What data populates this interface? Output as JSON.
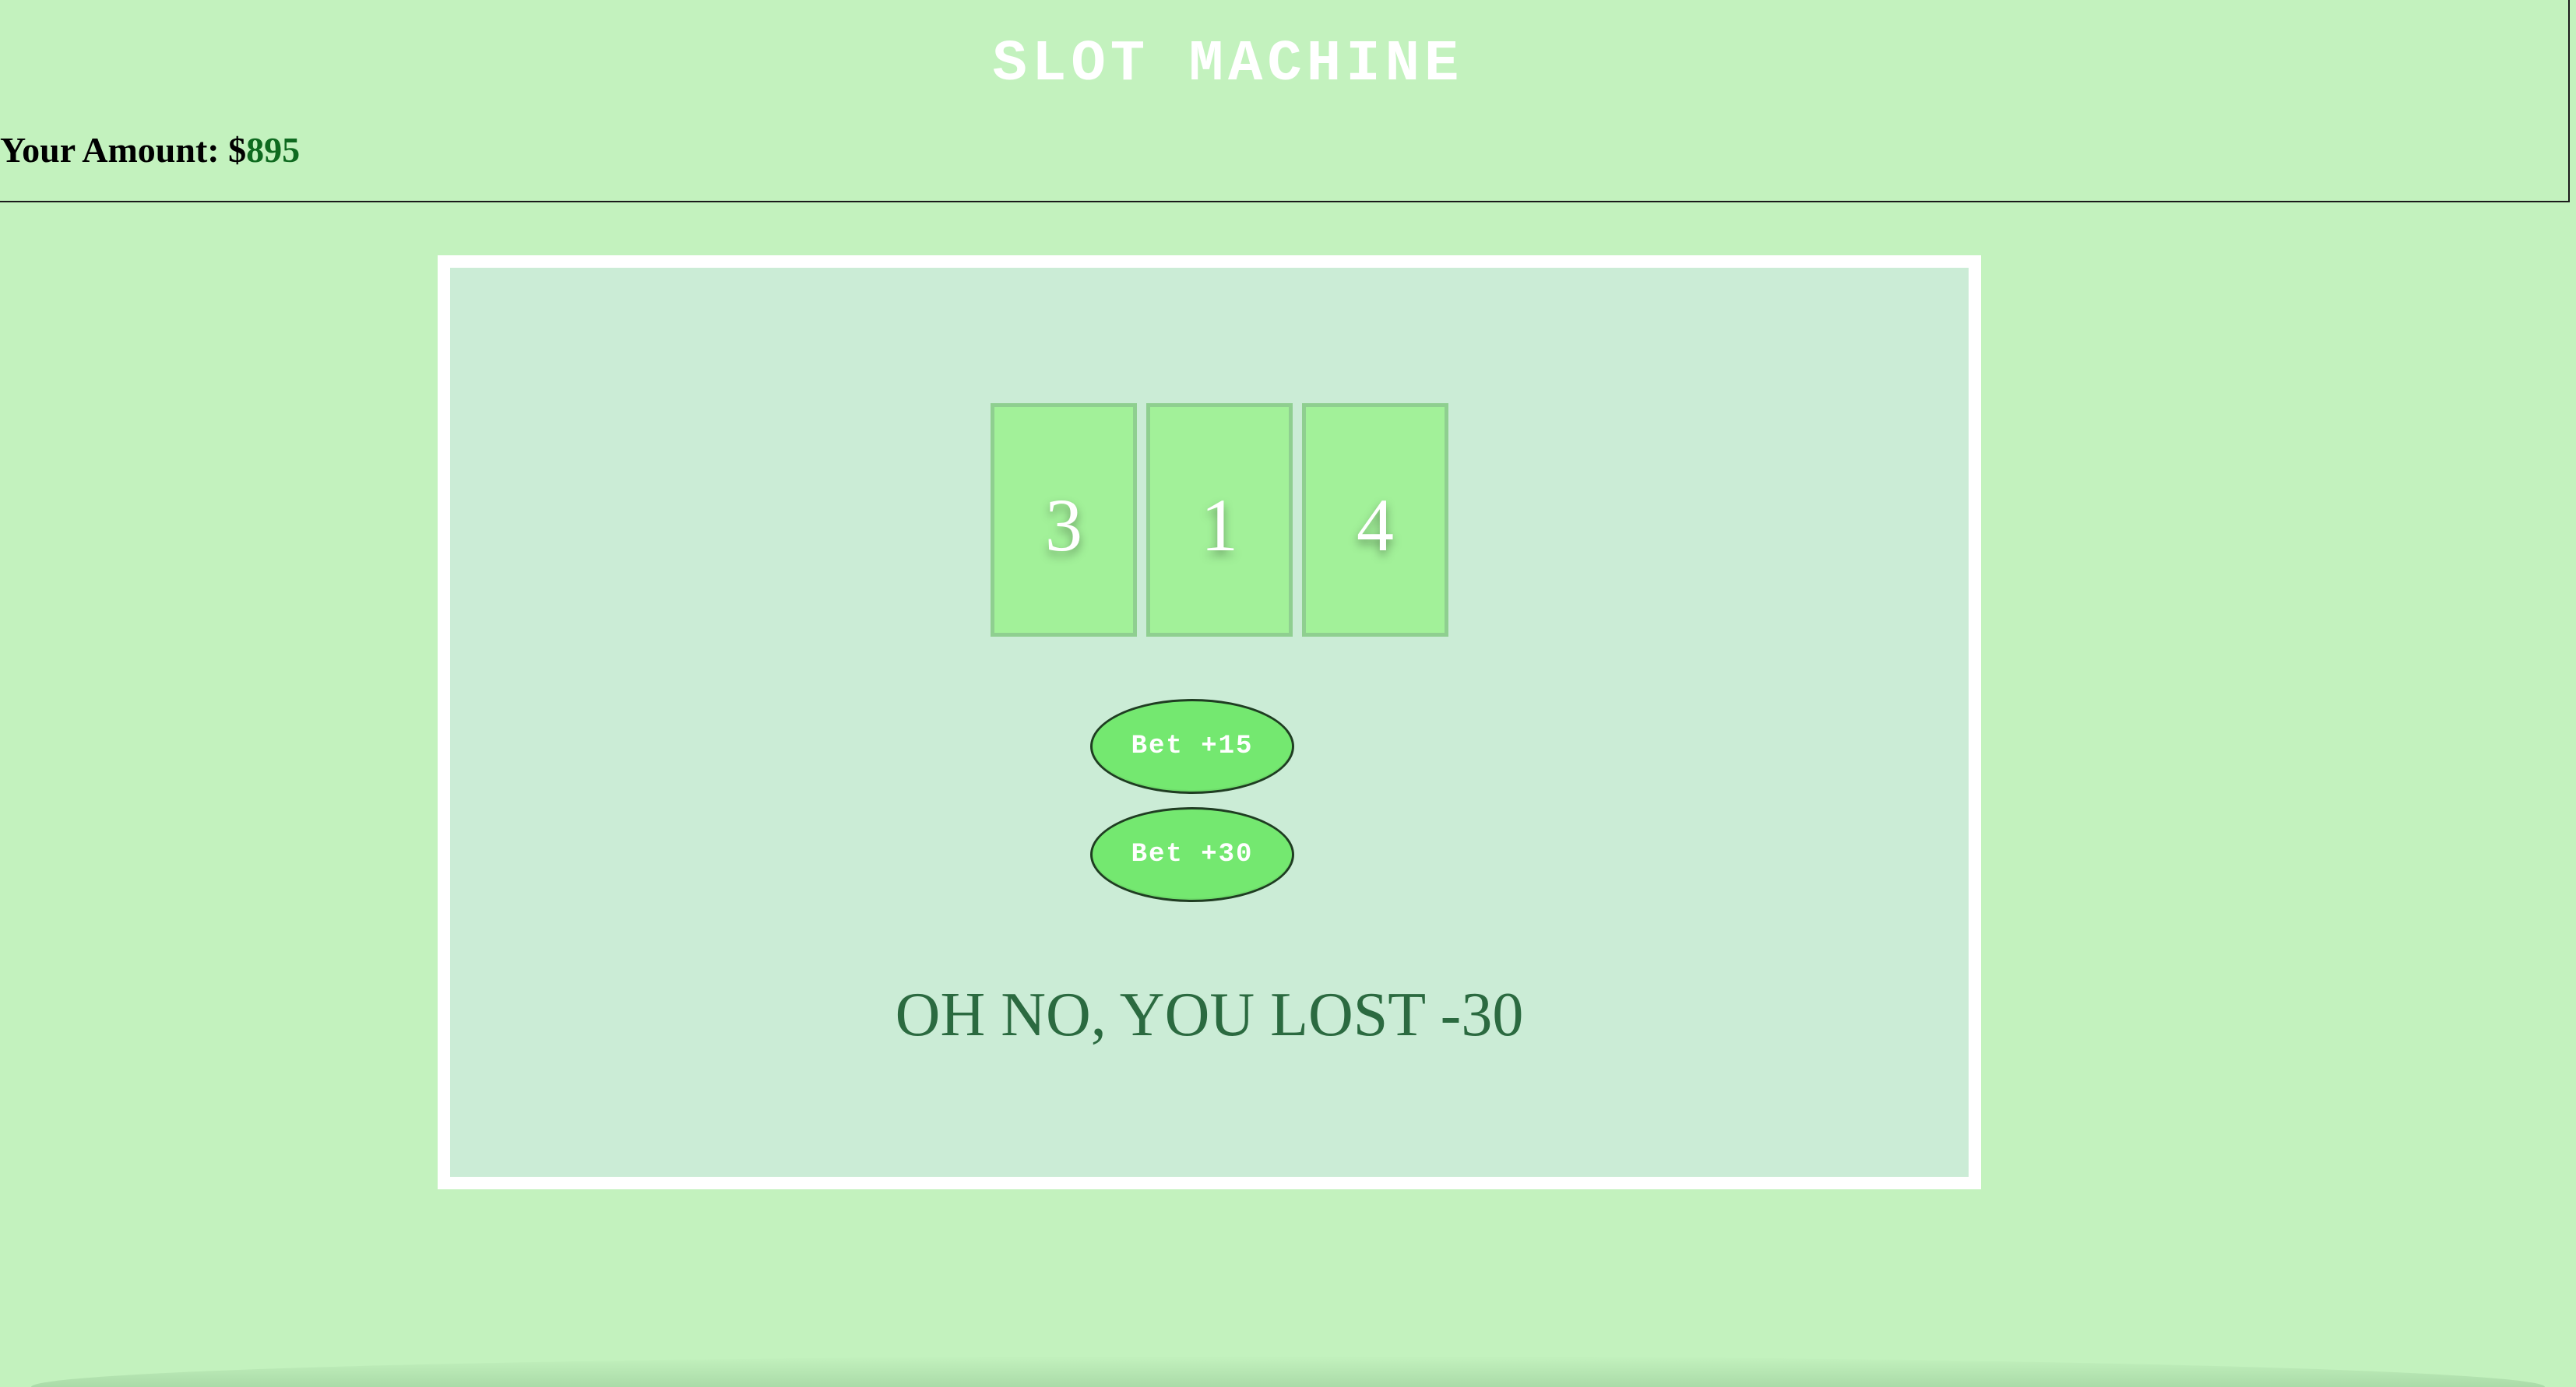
{
  "header": {
    "title": "SLOT MACHINE",
    "amount_label": "Your Amount: $",
    "amount_value": "895"
  },
  "reels": [
    "3",
    "1",
    "4"
  ],
  "buttons": {
    "bet_15_label": "Bet +15",
    "bet_30_label": "Bet +30"
  },
  "result": {
    "message": "OH NO, YOU LOST -30"
  },
  "colors": {
    "background": "#c3f2be",
    "panel": "#cbecd6",
    "reel": "#a2f199",
    "button": "#74e870",
    "amount_value": "#0e6a1f",
    "result_text": "#2b6a40"
  }
}
